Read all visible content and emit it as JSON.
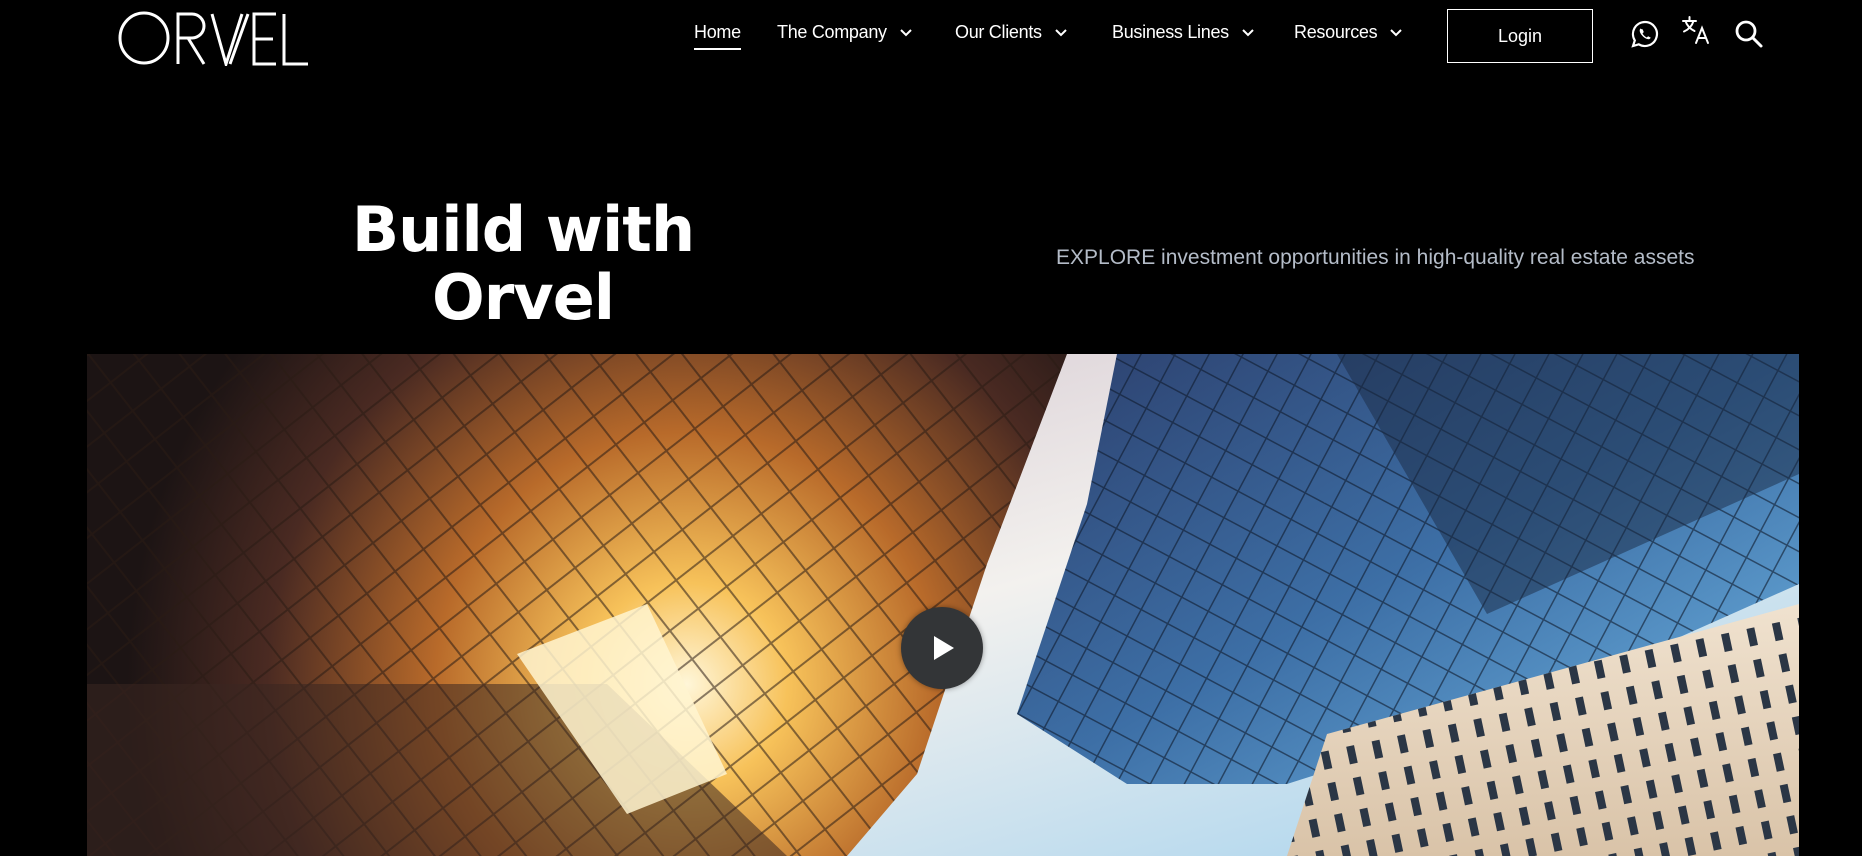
{
  "header": {
    "logo_text": "ORVEL",
    "nav": {
      "home": "Home",
      "items": [
        {
          "label": "The Company"
        },
        {
          "label": "Our Clients"
        },
        {
          "label": "Business Lines"
        },
        {
          "label": "Resources"
        }
      ]
    },
    "login_label": "Login",
    "icons": [
      "whatsapp-icon",
      "translate-icon",
      "search-icon"
    ]
  },
  "hero": {
    "title_line1": "Build with",
    "title_line2": "Orvel",
    "subtitle": "EXPLORE investment opportunities in high-quality real estate assets"
  },
  "media": {
    "play_icon": "play-icon"
  },
  "colors": {
    "background": "#000000",
    "text": "#ffffff",
    "subtitle": "#b4bcc8",
    "play_button": "#333537"
  }
}
